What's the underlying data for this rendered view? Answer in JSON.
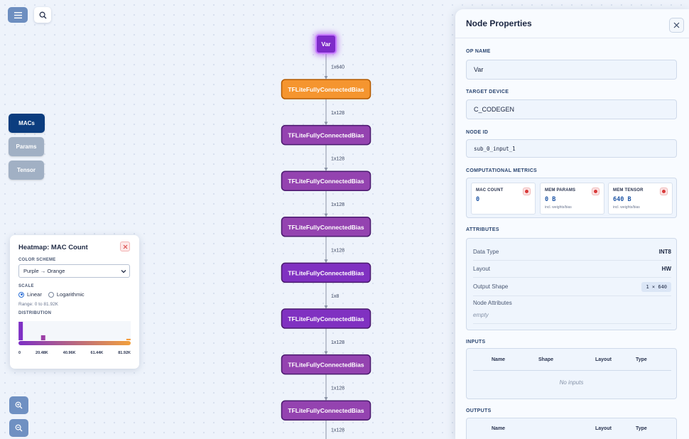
{
  "toolbar": {
    "menu_icon": "menu-icon",
    "search_icon": "search-icon"
  },
  "metric_tabs": [
    {
      "label": "MACs",
      "active": true
    },
    {
      "label": "Params",
      "active": false
    },
    {
      "label": "Tensor",
      "active": false
    }
  ],
  "heatmap": {
    "title": "Heatmap: MAC Count",
    "color_scheme_label": "COLOR SCHEME",
    "color_scheme_value": "Purple → Orange",
    "scale_label": "SCALE",
    "scale_options": [
      "Linear",
      "Logarithmic"
    ],
    "scale_selected": "Linear",
    "range": "Range: 0 to 81.92K",
    "distribution_label": "DISTRIBUTION",
    "axis_ticks": [
      "0",
      "20.48K",
      "40.96K",
      "61.44K",
      "81.92K"
    ]
  },
  "chart_data": {
    "type": "bar",
    "title": "DISTRIBUTION",
    "x": [
      "0",
      "20.48K",
      "40.96K",
      "61.44K",
      "81.92K"
    ],
    "bins": [
      {
        "position": 0.02,
        "value": 1.0,
        "color": "#7e2fc4"
      },
      {
        "position": 0.22,
        "value": 0.27,
        "color": "#9c3fa6"
      },
      {
        "position": 0.98,
        "value": 0.08,
        "color": "#f59a3a"
      }
    ],
    "gradient": [
      "#7e2fc4",
      "#f2a03c"
    ]
  },
  "graph": {
    "nodes": [
      {
        "label": "Var",
        "kind": "input"
      },
      {
        "label": "TFLiteFullyConnectedBias",
        "kind": "selected"
      },
      {
        "label": "TFLiteFullyConnectedBias",
        "kind": "op"
      },
      {
        "label": "TFLiteFullyConnectedBias",
        "kind": "op"
      },
      {
        "label": "TFLiteFullyConnectedBias",
        "kind": "op"
      },
      {
        "label": "TFLiteFullyConnectedBias",
        "kind": "op"
      },
      {
        "label": "TFLiteFullyConnectedBias",
        "kind": "op"
      },
      {
        "label": "TFLiteFullyConnectedBias",
        "kind": "op"
      },
      {
        "label": "TFLiteFullyConnectedBias",
        "kind": "op"
      }
    ],
    "edges": [
      "1x640",
      "1x128",
      "1x128",
      "1x128",
      "1x128",
      "1x8",
      "1x128",
      "1x128",
      "1x128"
    ]
  },
  "props": {
    "title": "Node Properties",
    "op_name_label": "OP NAME",
    "op_name": "Var",
    "target_device_label": "TARGET DEVICE",
    "target_device": "C_CODEGEN",
    "node_id_label": "NODE ID",
    "node_id": "sub_0_input_1",
    "metrics_label": "COMPUTATIONAL METRICS",
    "metrics": [
      {
        "label": "MAC COUNT",
        "value": "0",
        "sub": ""
      },
      {
        "label": "MEM PARAMS",
        "value": "0 B",
        "sub": "incl. weights/bias"
      },
      {
        "label": "MEM TENSOR",
        "value": "640 B",
        "sub": "incl. weights/bias"
      }
    ],
    "attributes_label": "ATTRIBUTES",
    "attributes": {
      "data_type_key": "Data Type",
      "data_type": "INT8",
      "layout_key": "Layout",
      "layout": "HW",
      "output_shape_key": "Output Shape",
      "output_shape": "1 × 640",
      "node_attrs_key": "Node Attributes",
      "node_attrs": "empty"
    },
    "inputs_label": "INPUTS",
    "inputs_headers": [
      "Name",
      "Shape",
      "Layout",
      "Type"
    ],
    "inputs_empty": "No inputs",
    "outputs_label": "OUTPUTS",
    "outputs_headers": [
      "Name",
      "Layout",
      "Type"
    ]
  },
  "zoom": {
    "in_icon": "zoom-in-icon",
    "out_icon": "zoom-out-icon"
  }
}
